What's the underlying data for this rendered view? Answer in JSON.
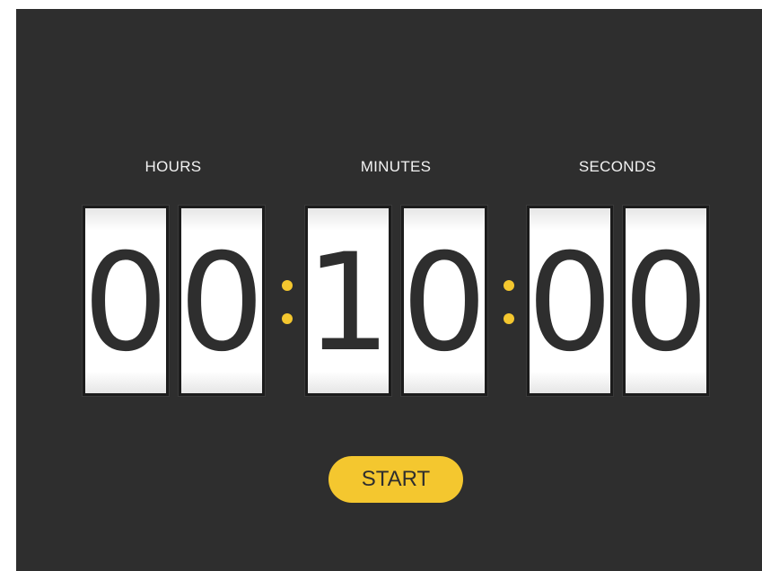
{
  "labels": {
    "hours": "HOURS",
    "minutes": "MINUTES",
    "seconds": "SECONDS"
  },
  "digits": {
    "hours": [
      "0",
      "0"
    ],
    "minutes": [
      "1",
      "0"
    ],
    "seconds": [
      "0",
      "0"
    ]
  },
  "separator_color": "#f4c72f",
  "start_button": {
    "label": "START",
    "color": "#f4c72f"
  },
  "background_color": "#2e2e2e"
}
